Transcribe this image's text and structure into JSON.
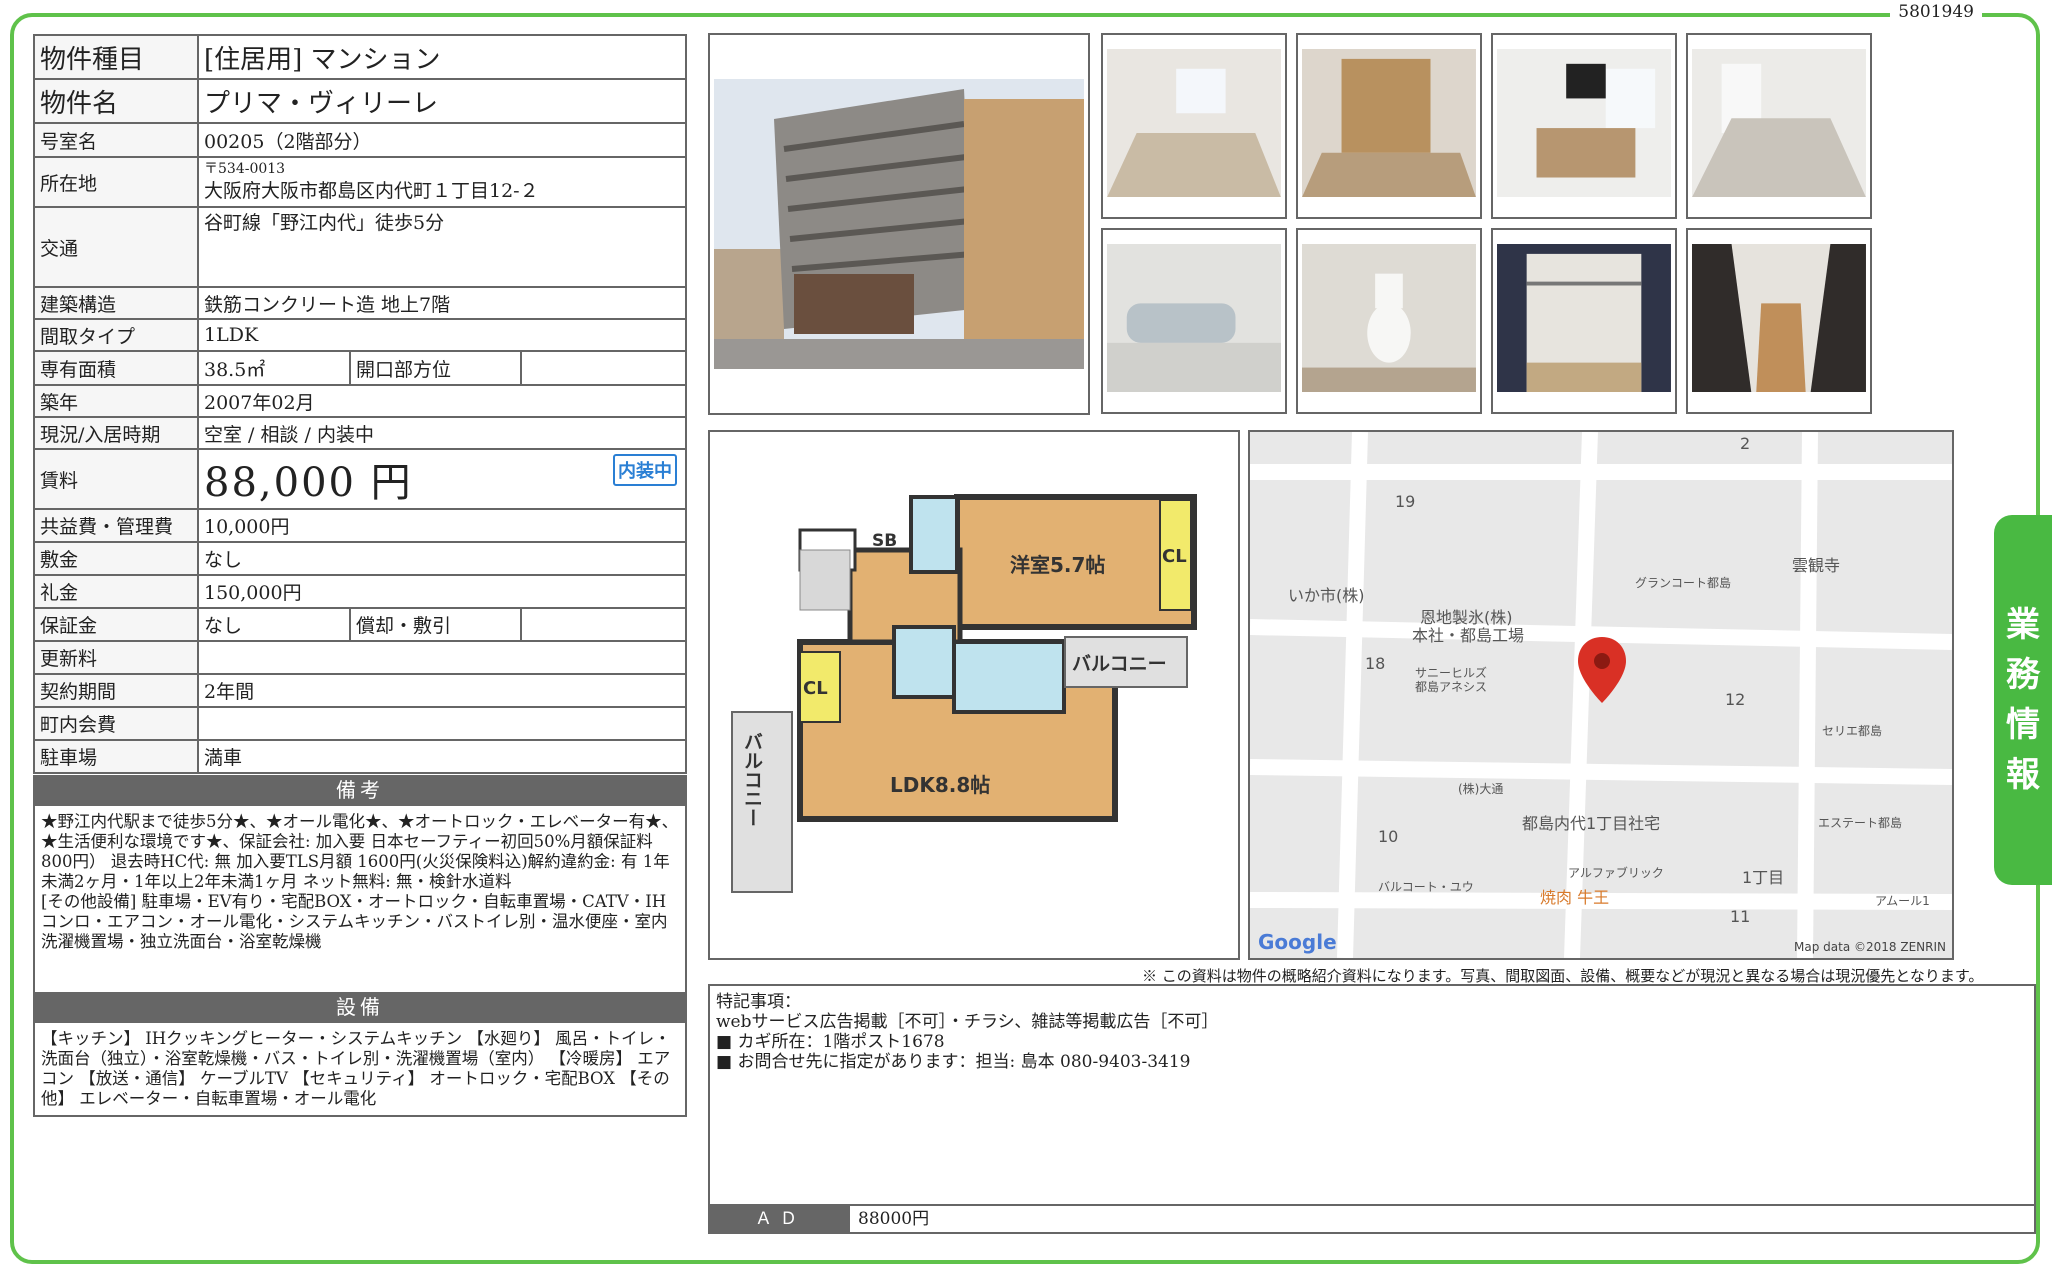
{
  "doc_id": "5801949",
  "side_tab": [
    "業",
    "務",
    "情",
    "報"
  ],
  "property": {
    "type_label": "物件種目",
    "type_value": "[住居用] マンション",
    "name_label": "物件名",
    "name_value": "プリマ・ヴィリーレ",
    "room_label": "号室名",
    "room_value": "00205（2階部分）",
    "address_label": "所在地",
    "postal": "〒534-0013",
    "address": "大阪府大阪市都島区内代町１丁目12-２",
    "transport_label": "交通",
    "transport_value": "谷町線「野江内代」徒歩5分",
    "structure_label": "建築構造",
    "structure_value": "鉄筋コンクリート造 地上7階",
    "layout_label": "間取タイプ",
    "layout_value": "1LDK",
    "area_label": "専有面積",
    "area_value": "38.5㎡",
    "direction_label": "開口部方位",
    "direction_value": "",
    "built_label": "築年",
    "built_value": "2007年02月",
    "status_label": "現況/入居時期",
    "status_value": "空室 / 相談 / 内装中",
    "rent_label": "賃料",
    "rent_value": "88,000 円",
    "badge": "内装中",
    "fee_label": "共益費・管理費",
    "fee_value": "10,000円",
    "deposit_label": "敷金",
    "deposit_value": "なし",
    "key_money_label": "礼金",
    "key_money_value": "150,000円",
    "guarantee_label": "保証金",
    "guarantee_value": "なし",
    "amort_label": "償却・敷引",
    "amort_value": "",
    "renewal_label": "更新料",
    "renewal_value": "",
    "term_label": "契約期間",
    "term_value": "2年間",
    "community_label": "町内会費",
    "community_value": "",
    "parking_label": "駐車場",
    "parking_value": "満車"
  },
  "remarks": {
    "title": "備考",
    "text": "★野江内代駅まで徒歩5分★、★オール電化★、★オートロック・エレベーター有★、★生活便利な環境です★、保証会社: 加入要 日本セーフティー初回50%月額保証料800円） 退去時HC代: 無 加入要TLS月額 1600円(火災保険料込)解約違約金: 有 1年未満2ヶ月・1年以上2年未満1ヶ月 ネット無料: 無・検針水道料\n[その他設備] 駐車場・EV有り・宅配BOX・オートロック・自転車置場・CATV・IHコンロ・エアコン・オール電化・システムキッチン・バストイレ別・温水便座・室内洗濯機置場・独立洗面台・浴室乾燥機"
  },
  "equipment": {
    "title": "設備",
    "text": "【キッチン】 IHクッキングヒーター・システムキッチン 【水廻り】 風呂・トイレ・洗面台（独立）・浴室乾燥機・バス・トイレ別・洗濯機置場（室内） 【冷暖房】 エアコン 【放送・通信】 ケーブルTV 【セキュリティ】 オートロック・宅配BOX 【その他】 エレベーター・自転車置場・オール電化"
  },
  "floorplan": {
    "room1": "洋室5.7帖",
    "ldk": "LDK8.8帖",
    "sb": "SB",
    "cl1": "CL",
    "cl2": "CL",
    "balcony1": "バルコニー",
    "balcony2": "バルコニー"
  },
  "map": {
    "labels": [
      "19",
      "2",
      "18",
      "12",
      "10",
      "11",
      "1丁目",
      "いか市(株)",
      "恩地製氷(株)",
      "本社・都島工場",
      "サニーヒルズ",
      "都島アネシス",
      "グランコート都島",
      "雲観寺",
      "セリエ都島",
      "(株)大通",
      "都島内代1丁目社宅",
      "エステート都島",
      "アルファブリック",
      "バルコート・ユウ",
      "焼肉 牛王",
      "アムール1"
    ],
    "google": "Google",
    "copyright": "Map data ©2018 ZENRIN"
  },
  "disclaimer": "※ この資料は物件の概略紹介資料になります。写真、間取図面、設備、概要などが現況と異なる場合は現況優先となります。",
  "notes": {
    "header": "特記事項：",
    "lines": [
      "webサービス広告掲載［不可］・チラシ、雑誌等掲載広告［不可］",
      "■ カギ所在：1階ポスト1678",
      "■ お問合せ先に指定があります：担当: 島本 080-9403-3419"
    ],
    "ad_label": "ＡＤ",
    "ad_value": "88000円"
  },
  "colors": {
    "frame": "#5fc24a",
    "tab": "#49b942",
    "band": "#666666",
    "badge": "#2a7fd4"
  }
}
